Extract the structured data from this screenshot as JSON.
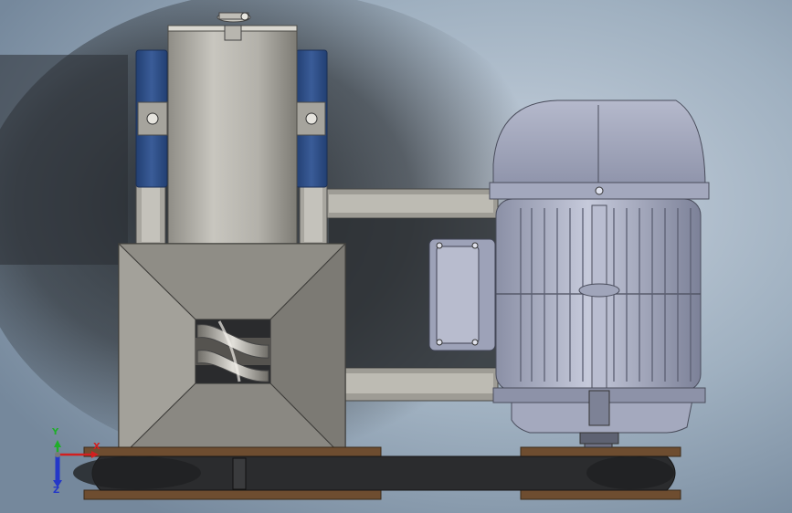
{
  "view": {
    "background_colors": [
      "#b9c6d4",
      "#8fa0b1",
      "#2e3338"
    ],
    "accent_blue": "#2f4f86",
    "steel_color": "#a9a7a0",
    "motor_color": "#9aa0b8",
    "belt_color": "#2b2c2e",
    "pulley_color": "#7a5a3a"
  },
  "triad": {
    "x_label": "X",
    "y_label": "Y",
    "z_label": "Z",
    "x_color": "#d21f1f",
    "y_color": "#1fae2a",
    "z_color": "#2438c8"
  },
  "parts": {
    "hopper": "hopper-icon",
    "auger": "auger-icon",
    "cylinder": "cylinder-icon",
    "motor": "motor-icon",
    "belt": "belt-icon"
  }
}
